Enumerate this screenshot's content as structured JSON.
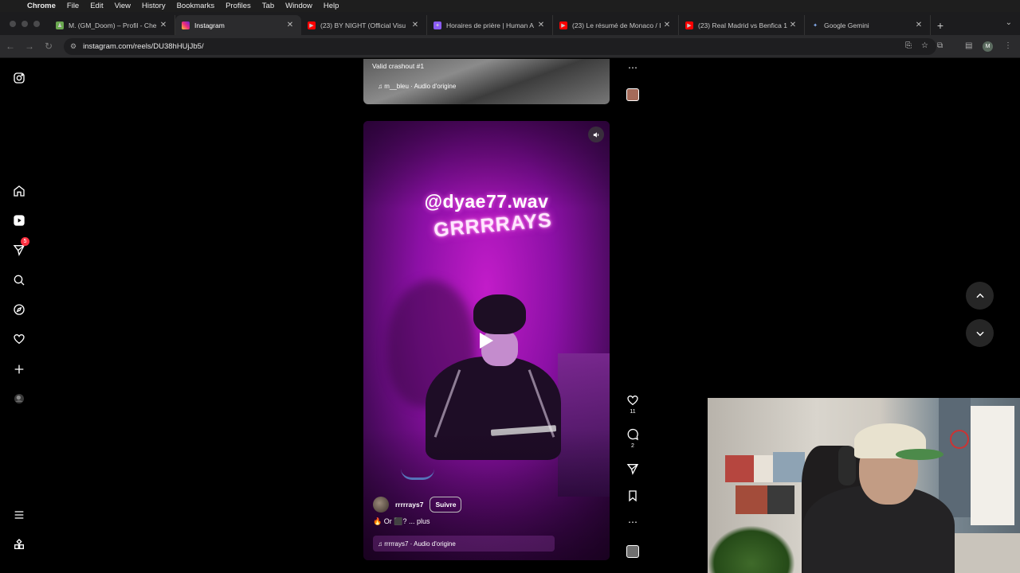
{
  "menubar": {
    "items": [
      "Chrome",
      "File",
      "Edit",
      "View",
      "History",
      "Bookmarks",
      "Profiles",
      "Tab",
      "Window",
      "Help"
    ]
  },
  "tabs": [
    {
      "label": "M. (GM_Doom) – Profil - Che",
      "favicon": "chess-icon",
      "color": "#6aa84f"
    },
    {
      "label": "Instagram",
      "favicon": "instagram-icon",
      "color": "#e1306c"
    },
    {
      "label": "(23) BY NIGHT (Official Visu",
      "favicon": "youtube-icon",
      "color": "#ff0000"
    },
    {
      "label": "Horaires de prière | Human A",
      "favicon": "app-icon",
      "color": "#8b5cf6"
    },
    {
      "label": "(23) Le résumé de Monaco / I",
      "favicon": "youtube-icon",
      "color": "#ff0000"
    },
    {
      "label": "(23) Real Madrid vs Benfica 1",
      "favicon": "youtube-icon",
      "color": "#ff0000"
    },
    {
      "label": "Google Gemini",
      "favicon": "gemini-icon",
      "color": "#4285f4"
    }
  ],
  "toolbar": {
    "url": "instagram.com/reels/DU38hHUjJb5/",
    "profile_initial": "M"
  },
  "sidenav": {
    "notification_count": "5"
  },
  "prev_reel": {
    "caption": "Valid crashout #1",
    "audio": "m__bleu · Audio d'origine"
  },
  "reel": {
    "overlay_line1": "@dyae77.wav",
    "overlay_line2": "GRRRRAYS",
    "username": "rrrrrays7",
    "follow_label": "Suivre",
    "caption_text": "Or ⬛? ...",
    "caption_more": "plus",
    "audio": "rrrrrays7 · Audio d'origine"
  },
  "actions": {
    "likes": "11",
    "comments": "2"
  }
}
